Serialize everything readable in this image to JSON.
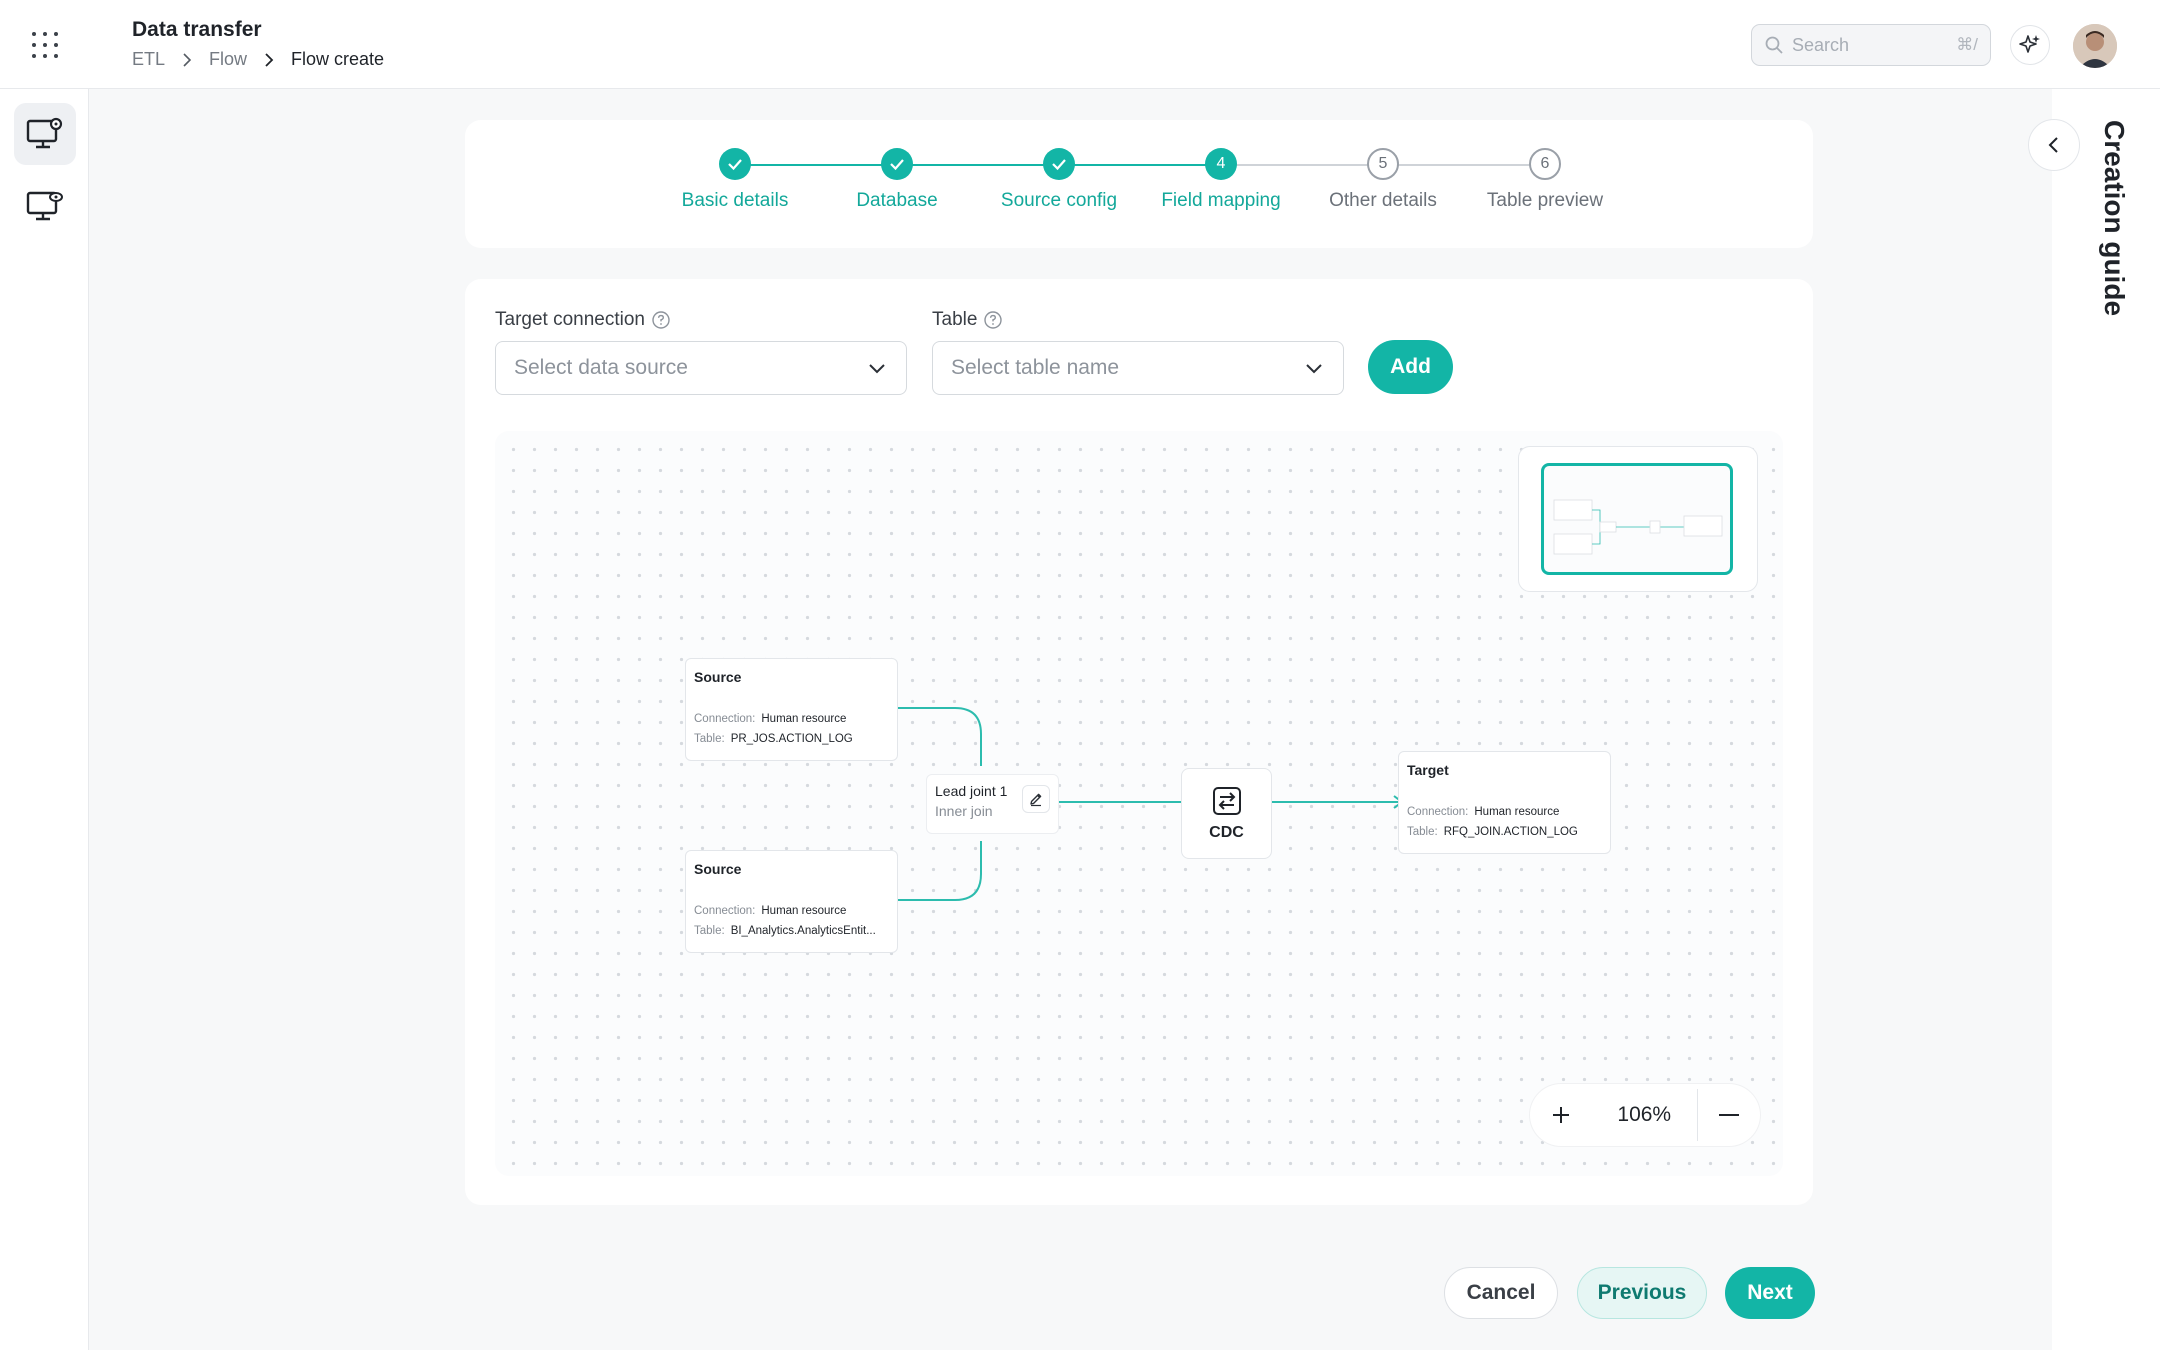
{
  "header": {
    "title": "Data transfer",
    "breadcrumb": [
      "ETL",
      "Flow",
      "Flow create"
    ],
    "search_placeholder": "Search",
    "search_shortcut": "⌘/"
  },
  "guide": {
    "title": "Creation guide"
  },
  "stepper": {
    "steps": [
      {
        "label": "Basic details",
        "state": "done"
      },
      {
        "label": "Database",
        "state": "done"
      },
      {
        "label": "Source config",
        "state": "done"
      },
      {
        "label": "Field mapping",
        "state": "current",
        "number": "4"
      },
      {
        "label": "Other details",
        "state": "todo",
        "number": "5"
      },
      {
        "label": "Table preview",
        "state": "todo",
        "number": "6"
      }
    ]
  },
  "form": {
    "target_connection_label": "Target connection",
    "target_connection_placeholder": "Select data source",
    "table_label": "Table",
    "table_placeholder": "Select table name",
    "add_label": "Add"
  },
  "flow": {
    "source1": {
      "title": "Source",
      "connection_key": "Connection:",
      "connection": "Human resource",
      "table_key": "Table:",
      "table": "PR_JOS.ACTION_LOG"
    },
    "source2": {
      "title": "Source",
      "connection_key": "Connection:",
      "connection": "Human resource",
      "table_key": "Table:",
      "table": "BI_Analytics.AnalyticsEntit..."
    },
    "join": {
      "title": "Lead joint 1",
      "subtitle": "Inner join"
    },
    "cdc": {
      "label": "CDC"
    },
    "target": {
      "title": "Target",
      "connection_key": "Connection:",
      "connection": "Human resource",
      "table_key": "Table:",
      "table": "RFQ_JOIN.ACTION_LOG"
    }
  },
  "zoom": {
    "value": "106%"
  },
  "footer": {
    "cancel": "Cancel",
    "previous": "Previous",
    "next": "Next"
  },
  "colors": {
    "accent": "#13b5a6",
    "accent_text": "#13a89a"
  }
}
